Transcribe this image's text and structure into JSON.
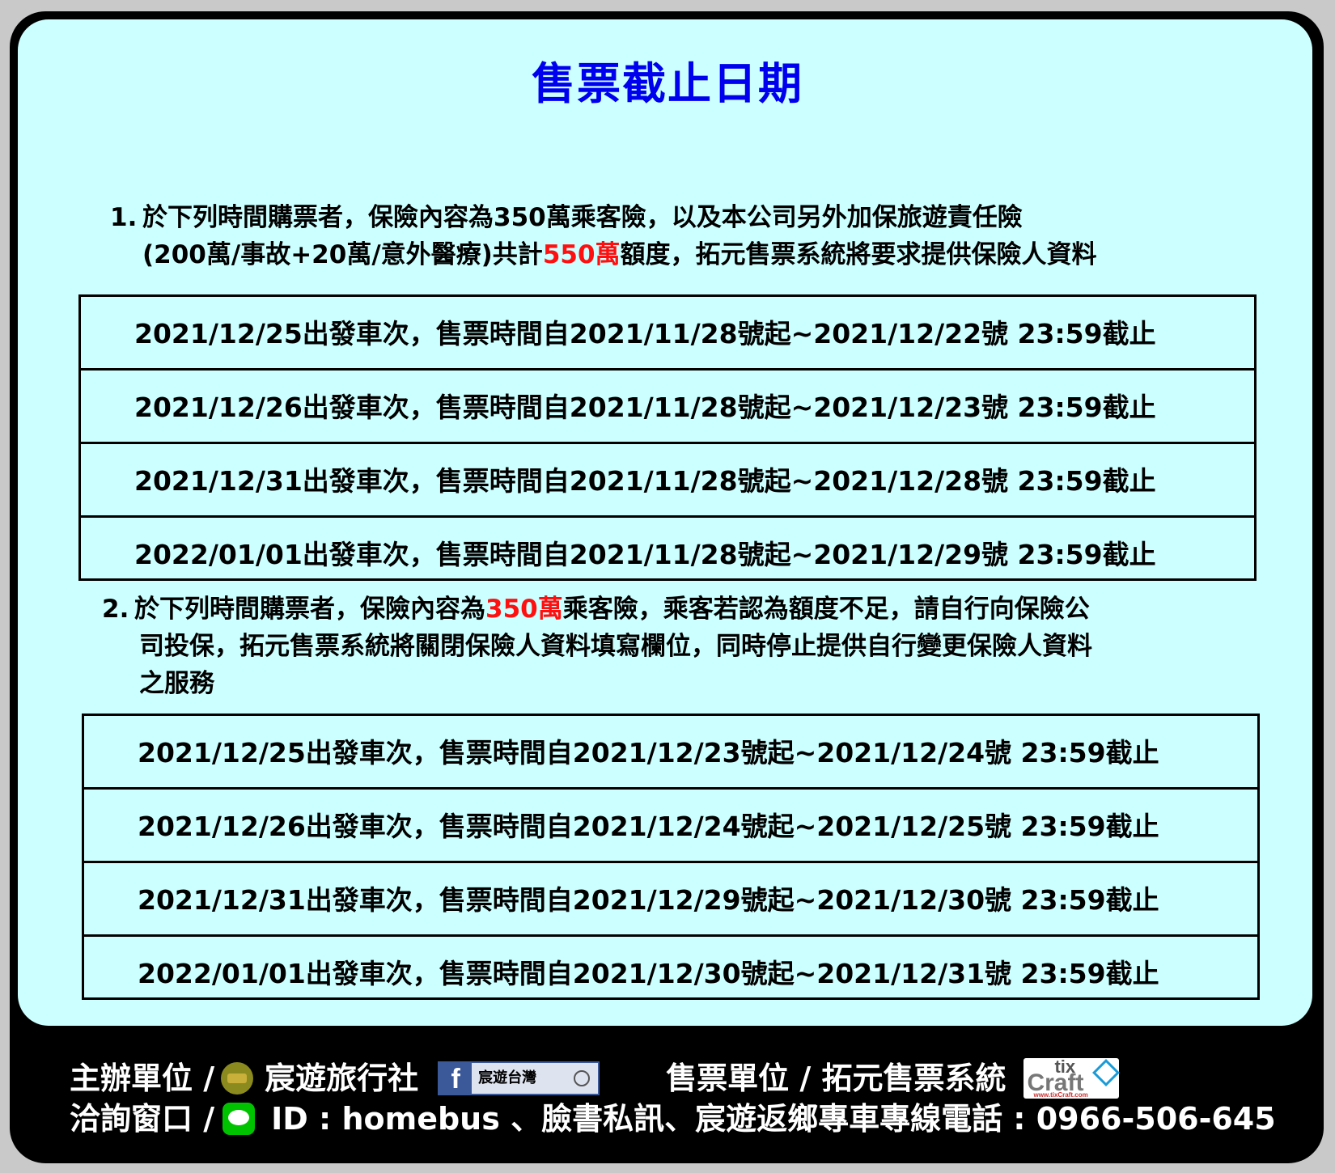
{
  "title": "售票截止日期",
  "section1": {
    "num": "1.",
    "line1": "於下列時間購票者，保險內容為350萬乘客險，以及本公司另外加保旅遊責任險",
    "line2_before": "(200萬/事故+20萬/意外醫療)共計",
    "line2_highlight": "550萬",
    "line2_after": "額度，拓元售票系統將要求提供保險人資料",
    "rows": [
      "2021/12/25出發車次，售票時間自2021/11/28號起~2021/12/22號 23:59截止",
      "2021/12/26出發車次，售票時間自2021/11/28號起~2021/12/23號 23:59截止",
      "2021/12/31出發車次，售票時間自2021/11/28號起~2021/12/28號 23:59截止",
      "2022/01/01出發車次，售票時間自2021/11/28號起~2021/12/29號 23:59截止"
    ]
  },
  "section2": {
    "num": "2.",
    "line1_before": "於下列時間購票者，保險內容為",
    "line1_highlight": "350萬",
    "line1_after": "乘客險，乘客若認為額度不足，請自行向保險公",
    "line2": "司投保，拓元售票系統將關閉保險人資料填寫欄位，同時停止提供自行變更保險人資料",
    "line3": "之服務",
    "rows": [
      "2021/12/25出發車次，售票時間自2021/12/23號起~2021/12/24號 23:59截止",
      "2021/12/26出發車次，售票時間自2021/12/24號起~2021/12/25號 23:59截止",
      "2021/12/31出發車次，售票時間自2021/12/29號起~2021/12/30號 23:59截止",
      "2022/01/01出發車次，售票時間自2021/12/30號起~2021/12/31號 23:59截止"
    ]
  },
  "footer": {
    "organizer_label": "主辦單位 /",
    "organizer_name": "宸遊旅行社",
    "facebook_page": "宸遊台灣",
    "ticketing_label": "售票單位 / 拓元售票系統",
    "tix_logo_top": "tix",
    "tix_logo_main": "Craft",
    "tix_logo_url": "www.tixCraft.com",
    "contact_label": "洽詢窗口 /",
    "contact_info": "ID : homebus 、臉書私訊、宸遊返鄉專車專線電話 : 0966-506-645"
  },
  "colors": {
    "title": "#0000ee",
    "highlight": "#ff1010",
    "panel": "#ccffff",
    "footer_bg": "#000000"
  },
  "icons": [
    "organizer-logo-icon",
    "facebook-icon",
    "search-icon",
    "tixcraft-logo-icon",
    "line-app-icon"
  ]
}
